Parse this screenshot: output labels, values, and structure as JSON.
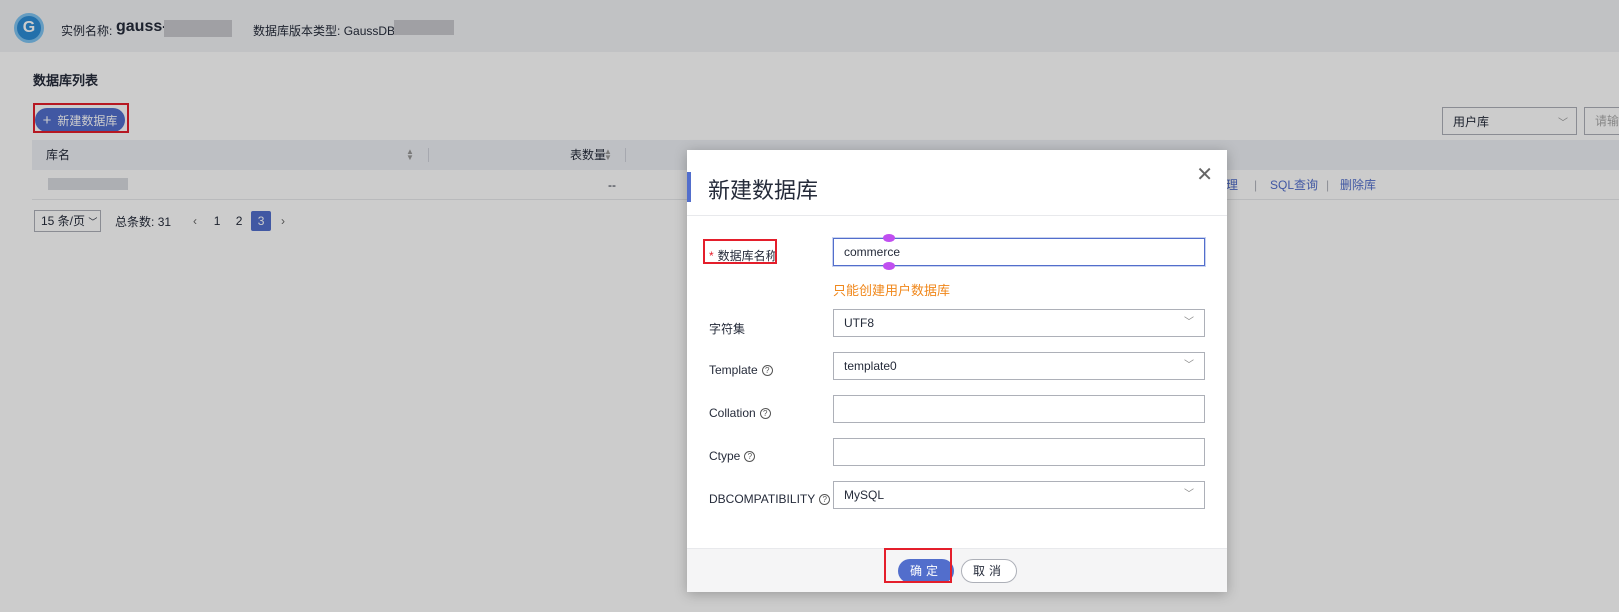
{
  "header": {
    "logo_letter": "G",
    "instance_label": "实例名称:",
    "instance_name": "gauss-",
    "version_label": "数据库版本类型:",
    "version_value": "GaussDB V:"
  },
  "page": {
    "title": "数据库列表",
    "create_button": "新建数据库",
    "filter_select": "用户库",
    "search_placeholder": "请输"
  },
  "table": {
    "columns": [
      "库名",
      "表数量"
    ],
    "rows": [
      {
        "table_count": "--",
        "actions": [
          "理",
          "SQL查询",
          "删除库"
        ]
      }
    ]
  },
  "pagination": {
    "page_size": "15 条/页",
    "total_label": "总条数:",
    "total": "31",
    "pages": [
      "1",
      "2",
      "3"
    ],
    "active_page": "3"
  },
  "dialog": {
    "title": "新建数据库",
    "fields": {
      "db_name": {
        "label": "数据库名称",
        "value": "commerce",
        "hint": "只能创建用户数据库"
      },
      "charset": {
        "label": "字符集",
        "value": "UTF8"
      },
      "template": {
        "label": "Template",
        "value": "template0"
      },
      "collation": {
        "label": "Collation",
        "value": ""
      },
      "ctype": {
        "label": "Ctype",
        "value": ""
      },
      "dbcompat": {
        "label": "DBCOMPATIBILITY",
        "value": "MySQL"
      }
    },
    "ok_label": "确定",
    "cancel_label": "取消"
  },
  "colors": {
    "primary": "#526ecc",
    "highlight": "#e41e2b",
    "hint": "#f0871a"
  }
}
